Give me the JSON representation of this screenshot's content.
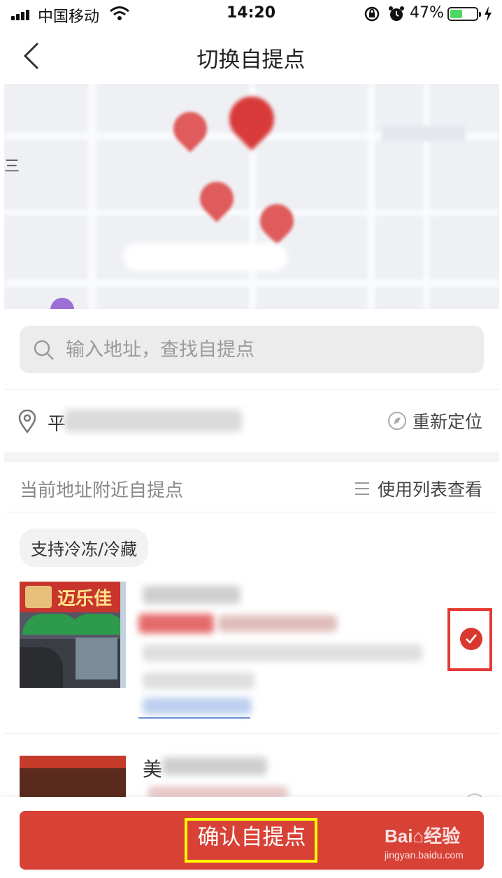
{
  "status_bar": {
    "carrier": "中国移动",
    "time": "14:20",
    "battery_percent": "47%",
    "battery_level": 0.47,
    "icons": [
      "signal-icon",
      "wifi-icon",
      "rotation-lock-icon",
      "alarm-icon",
      "battery-icon",
      "charging-icon"
    ]
  },
  "header": {
    "title": "切换自提点",
    "back_icon": "chevron-left-icon"
  },
  "map": {
    "edge_label": "三"
  },
  "search": {
    "placeholder": "输入地址，查找自提点"
  },
  "location": {
    "address_prefix": "平",
    "relocate_label": "重新定位"
  },
  "list": {
    "section_label": "当前地址附近自提点",
    "view_list_label": "使用列表查看",
    "tag": "支持冷冻/冷藏",
    "stores": [
      {
        "photo_sign_text": "迈乐佳",
        "selected": true
      },
      {
        "name_first_char": "美",
        "selected": false
      }
    ]
  },
  "bottom": {
    "confirm_label": "确认自提点"
  },
  "watermark": {
    "main": "Bai⌂经验",
    "sub": "jingyan.baidu.com"
  },
  "colors": {
    "brand_red": "#d84236",
    "check_red": "#d9382f",
    "highlight_red_frame": "#e53935",
    "highlight_yellow_frame": "#ffff00",
    "battery_green": "#4cd964"
  }
}
